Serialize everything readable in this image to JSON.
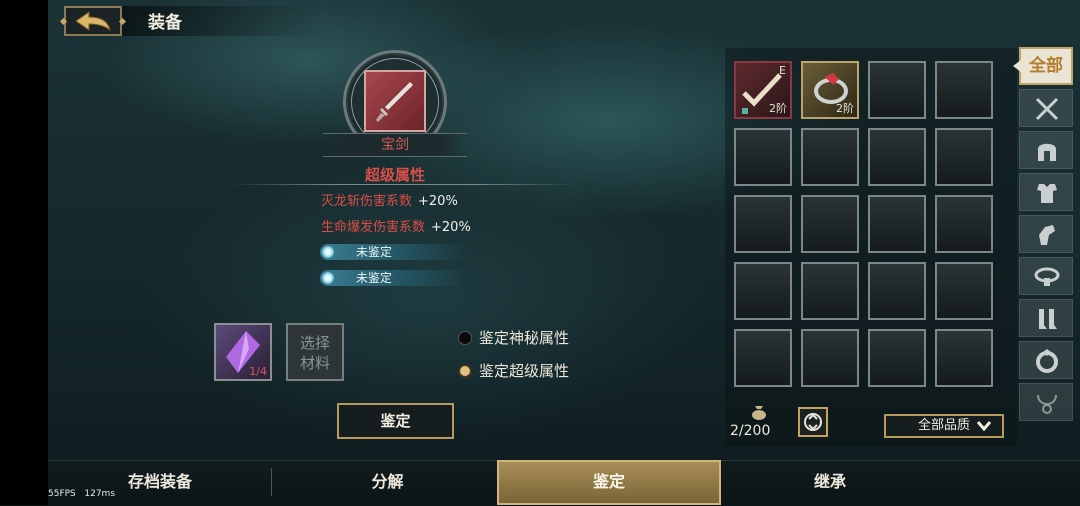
{
  "header": {
    "title": "装备"
  },
  "item": {
    "name": "宝剑",
    "section_title": "超级属性",
    "attributes": [
      {
        "name": "灭龙斩伤害系数",
        "value": "+20%"
      },
      {
        "name": "生命爆发伤害系数",
        "value": "+20%"
      }
    ],
    "unidentified": [
      "未鉴定",
      "未鉴定"
    ]
  },
  "materials": {
    "crystal_count": "1/4",
    "select_label_line1": "选择",
    "select_label_line2": "材料"
  },
  "options": {
    "mystic_label": "鉴定神秘属性",
    "super_label": "鉴定超级属性",
    "selected": "super"
  },
  "identify_button": "鉴定",
  "inventory": {
    "slot_levels": [
      "2阶",
      "2阶"
    ],
    "slot1_badge": "E",
    "capacity": "2/200",
    "quality_filter": "全部品质"
  },
  "category_tabs": {
    "all_label": "全部",
    "icons": [
      "crossed-swords-icon",
      "helmet-icon",
      "armor-icon",
      "gauntlet-icon",
      "belt-icon",
      "boots-icon",
      "ring-icon",
      "necklace-icon"
    ]
  },
  "bottom_tabs": [
    "存档装备",
    "分解",
    "鉴定",
    "继承"
  ],
  "debug": {
    "fps": "55FPS",
    "latency": "127ms"
  },
  "colors": {
    "accent_gold": "#c9a96a",
    "attribute_red": "#dc4d46",
    "rare_red": "#8a3a3e"
  }
}
